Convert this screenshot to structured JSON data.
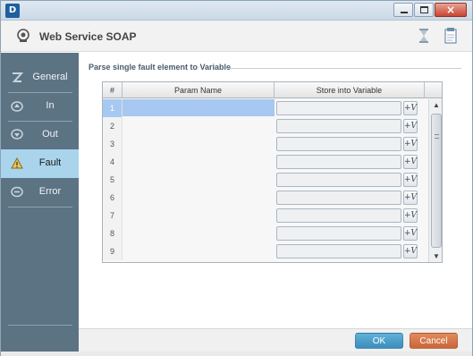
{
  "window": {
    "app_icon_letter": "D",
    "title": "Web Service SOAP"
  },
  "sidebar": {
    "items": [
      {
        "label": "General",
        "icon": "general-icon",
        "active": false
      },
      {
        "label": "In",
        "icon": "in-icon",
        "active": false
      },
      {
        "label": "Out",
        "icon": "out-icon",
        "active": false
      },
      {
        "label": "Fault",
        "icon": "fault-icon",
        "active": true
      },
      {
        "label": "Error",
        "icon": "error-icon",
        "active": false
      }
    ]
  },
  "main": {
    "group_title": "Parse single fault element to Variable",
    "columns": [
      "#",
      "Param Name",
      "Store into Variable"
    ],
    "rows": [
      {
        "num": "1",
        "param": "",
        "variable": ""
      },
      {
        "num": "2",
        "param": "",
        "variable": ""
      },
      {
        "num": "3",
        "param": "",
        "variable": ""
      },
      {
        "num": "4",
        "param": "",
        "variable": ""
      },
      {
        "num": "5",
        "param": "",
        "variable": ""
      },
      {
        "num": "6",
        "param": "",
        "variable": ""
      },
      {
        "num": "7",
        "param": "",
        "variable": ""
      },
      {
        "num": "8",
        "param": "",
        "variable": ""
      },
      {
        "num": "9",
        "param": "",
        "variable": ""
      }
    ],
    "variable_button_label": "+V"
  },
  "footer": {
    "ok_label": "OK",
    "cancel_label": "Cancel"
  },
  "colors": {
    "sidebar_bg": "#5c7384",
    "active_item_bg": "#a9d4ec",
    "ok_button": "#4a9fcc",
    "cancel_button": "#d7754a",
    "selected_row": "#a7c8f0"
  }
}
